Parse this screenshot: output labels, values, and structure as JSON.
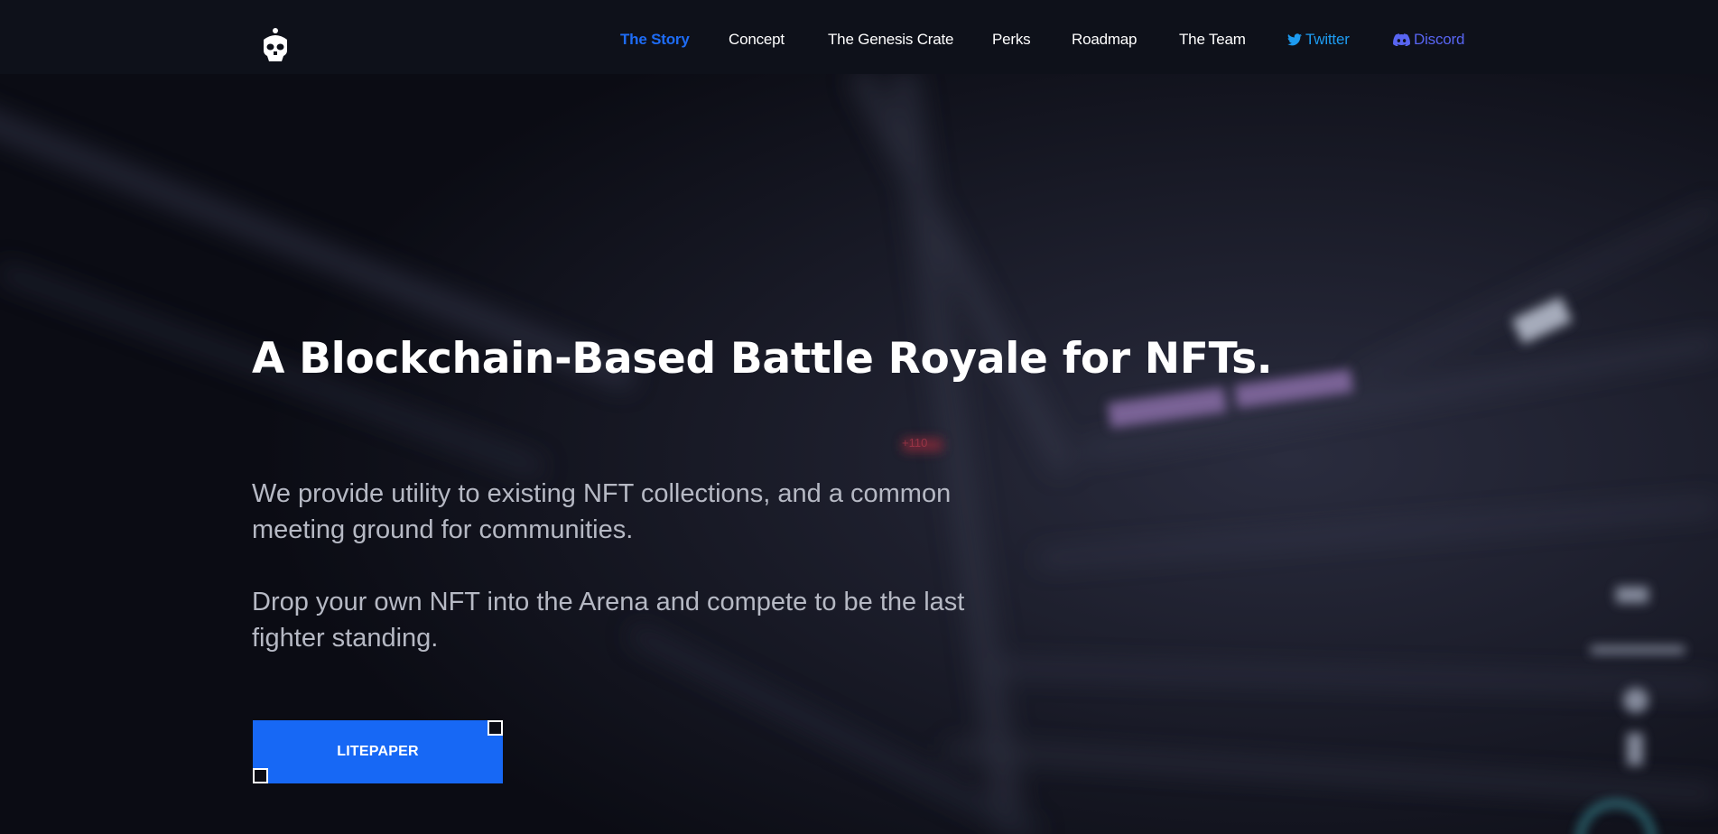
{
  "theme": {
    "accent": "#1768f5",
    "nav_active": "#1e6cf5",
    "twitter": "#1d9bf0",
    "discord": "#5865f2",
    "background": "#0b0c14"
  },
  "header": {
    "logo_icon": "skull-logo-icon",
    "nav": [
      {
        "label": "The Story",
        "active": true
      },
      {
        "label": "Concept"
      },
      {
        "label": "The Genesis Crate"
      },
      {
        "label": "Perks"
      },
      {
        "label": "Roadmap"
      },
      {
        "label": "The Team"
      },
      {
        "label": "Twitter",
        "icon": "twitter-icon"
      },
      {
        "label": "Discord",
        "icon": "discord-icon"
      }
    ]
  },
  "hero": {
    "title": "A Blockchain-Based Battle Royale for NFTs.",
    "paragraph_1": "We provide utility to existing NFT collections, and a common meeting ground for communities.",
    "paragraph_2": "Drop your own NFT into the Arena and compete to be the last fighter standing.",
    "cta_label": "LITEPAPER",
    "background_overlay_text": "+110"
  }
}
